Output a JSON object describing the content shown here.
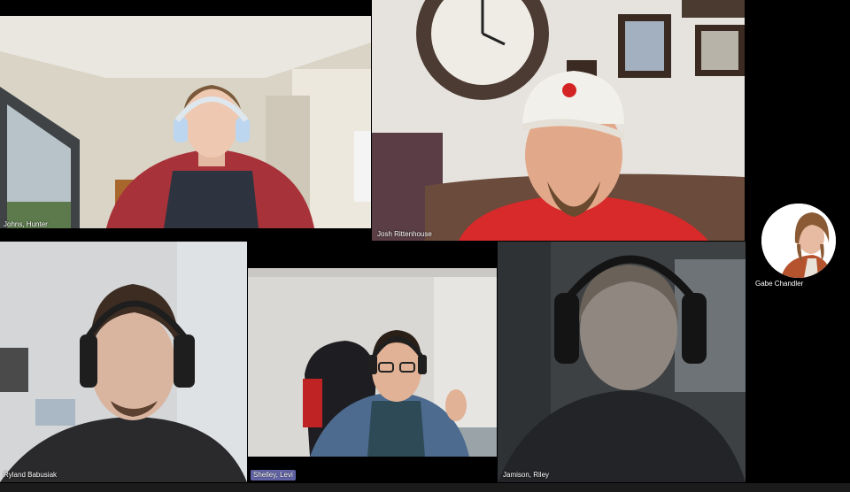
{
  "participants": [
    {
      "name": "Johns, Hunter"
    },
    {
      "name": "Josh Rittenhouse"
    },
    {
      "name": "Ryland Babusiak"
    },
    {
      "name": "Shelley, Levi"
    },
    {
      "name": "Jamison, Riley"
    }
  ],
  "side_participant": {
    "name": "Gabe Chandler"
  },
  "colors": {
    "background": "#000000",
    "highlight_label": "#6264a7"
  }
}
